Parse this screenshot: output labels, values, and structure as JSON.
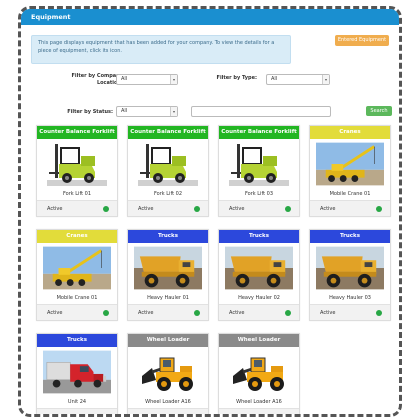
{
  "header": {
    "title": "Equipment"
  },
  "info_text": "This page displays equipment that has been added for your company. To view the details for a piece of equipment, click its icon.",
  "entered_button": "Entered Equipment",
  "filters": {
    "company_label": "Filter by Company Location:",
    "company_value": "All",
    "type_label": "Filter by Type:",
    "type_value": "All",
    "status_label": "Filter by Status:",
    "status_value": "All",
    "search_button": "Search"
  },
  "colors": {
    "forklift": "#22b622",
    "crane": "#e2dc3a",
    "truck": "#2c48dc",
    "loader": "#8a8a8a",
    "active": "#28a745"
  },
  "cards": [
    {
      "category": "Counter Balance Forklift",
      "name": "Fork Lift 01",
      "status": "Active",
      "icon": "forklift-image",
      "color": "#22b622"
    },
    {
      "category": "Counter Balance Forklift",
      "name": "Fork Lift 02",
      "status": "Active",
      "icon": "forklift-image",
      "color": "#22b622"
    },
    {
      "category": "Counter Balance Forklift",
      "name": "Fork Lift 03",
      "status": "Active",
      "icon": "forklift-image",
      "color": "#22b622"
    },
    {
      "category": "Cranes",
      "name": "Mobile Crane 01",
      "status": "Active",
      "icon": "crane-image",
      "color": "#e2dc3a"
    },
    {
      "category": "Cranes",
      "name": "Mobile Crane 01",
      "status": "Active",
      "icon": "crane-image",
      "color": "#e2dc3a"
    },
    {
      "category": "Trucks",
      "name": "Heavy Hauler 01",
      "status": "Active",
      "icon": "dump-truck-image",
      "color": "#2c48dc"
    },
    {
      "category": "Trucks",
      "name": "Heavy Hauler 02",
      "status": "Active",
      "icon": "dump-truck-image",
      "color": "#2c48dc"
    },
    {
      "category": "Trucks",
      "name": "Heavy Hauler 03",
      "status": "Active",
      "icon": "dump-truck-image",
      "color": "#2c48dc"
    },
    {
      "category": "Trucks",
      "name": "Unit 24",
      "status": "Active",
      "icon": "semi-truck-image",
      "color": "#2c48dc"
    },
    {
      "category": "Wheel Loader",
      "name": "Wheel Loader A16",
      "status": "Active",
      "icon": "wheel-loader-image",
      "color": "#8a8a8a"
    },
    {
      "category": "Wheel Loader",
      "name": "Wheel Loader A16",
      "status": "Active",
      "icon": "wheel-loader-image",
      "color": "#8a8a8a"
    }
  ]
}
